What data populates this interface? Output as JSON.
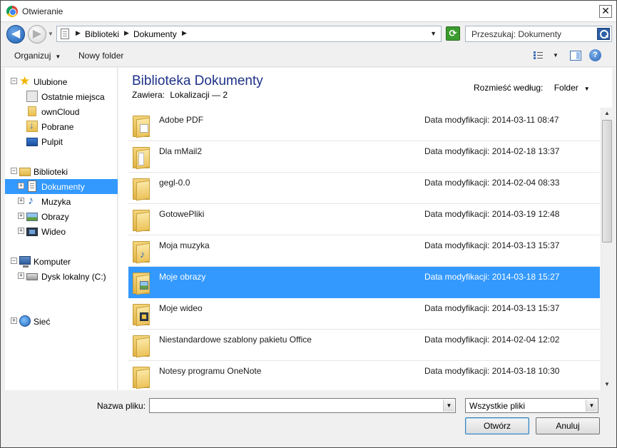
{
  "window": {
    "title": "Otwieranie",
    "close_glyph": "✕"
  },
  "address": {
    "back_glyph": "◀",
    "forward_glyph": "▶",
    "breadcrumbs": [
      "Biblioteki",
      "Dokumenty"
    ],
    "crumb_separator": "▶",
    "dropdown_glyph": "▼",
    "refresh_glyph": "⟳"
  },
  "search": {
    "placeholder": "Przeszukaj: Dokumenty"
  },
  "toolbar": {
    "organize_label": "Organizuj",
    "new_folder_label": "Nowy folder",
    "dropdown_glyph": "▼",
    "help_glyph": "?"
  },
  "nav": {
    "favorites": {
      "label": "Ulubione",
      "items": [
        {
          "label": "Ostatnie miejsca",
          "icon": "recent-places-icon"
        },
        {
          "label": "ownCloud",
          "icon": "folder-icon"
        },
        {
          "label": "Pobrane",
          "icon": "downloads-icon"
        },
        {
          "label": "Pulpit",
          "icon": "desktop-icon"
        }
      ]
    },
    "libraries": {
      "label": "Biblioteki",
      "items": [
        {
          "label": "Dokumenty",
          "icon": "documents-icon",
          "selected": true
        },
        {
          "label": "Muzyka",
          "icon": "music-icon"
        },
        {
          "label": "Obrazy",
          "icon": "pictures-icon"
        },
        {
          "label": "Wideo",
          "icon": "video-icon"
        }
      ]
    },
    "computer": {
      "label": "Komputer",
      "items": [
        {
          "label": "Dysk lokalny (C:)",
          "icon": "local-disk-icon"
        }
      ]
    },
    "network": {
      "label": "Sieć"
    },
    "collapse_glyph": "−",
    "expand_glyph": "+"
  },
  "main": {
    "title": "Biblioteka Dokumenty",
    "includes_label": "Zawiera:",
    "includes_value": "Lokalizacji — 2",
    "arrange_label": "Rozmieść według:",
    "arrange_value": "Folder",
    "date_label": "Data modyfikacji:",
    "files": [
      {
        "name": "Adobe PDF",
        "modified": "2014-03-11 08:47",
        "badge": "pdf"
      },
      {
        "name": "Dla mMail2",
        "modified": "2014-02-18 13:37",
        "badge": "white"
      },
      {
        "name": "gegl-0.0",
        "modified": "2014-02-04 08:33",
        "badge": "none"
      },
      {
        "name": "GotowePliki",
        "modified": "2014-03-19 12:48",
        "badge": "none"
      },
      {
        "name": "Moja muzyka",
        "modified": "2014-03-13 15:37",
        "badge": "note"
      },
      {
        "name": "Moje obrazy",
        "modified": "2014-03-18 15:27",
        "badge": "pic",
        "selected": true
      },
      {
        "name": "Moje wideo",
        "modified": "2014-03-13 15:37",
        "badge": "vid"
      },
      {
        "name": "Niestandardowe szablony pakietu Office",
        "modified": "2014-02-04 12:02",
        "badge": "none"
      },
      {
        "name": "Notesy programu OneNote",
        "modified": "2014-03-18 10:30",
        "badge": "none"
      }
    ]
  },
  "bottom": {
    "filename_label": "Nazwa pliku:",
    "filename_value": "",
    "filter_value": "Wszystkie pliki",
    "open_label": "Otwórz",
    "cancel_label": "Anuluj"
  },
  "scroll": {
    "up_glyph": "▲",
    "down_glyph": "▼"
  }
}
